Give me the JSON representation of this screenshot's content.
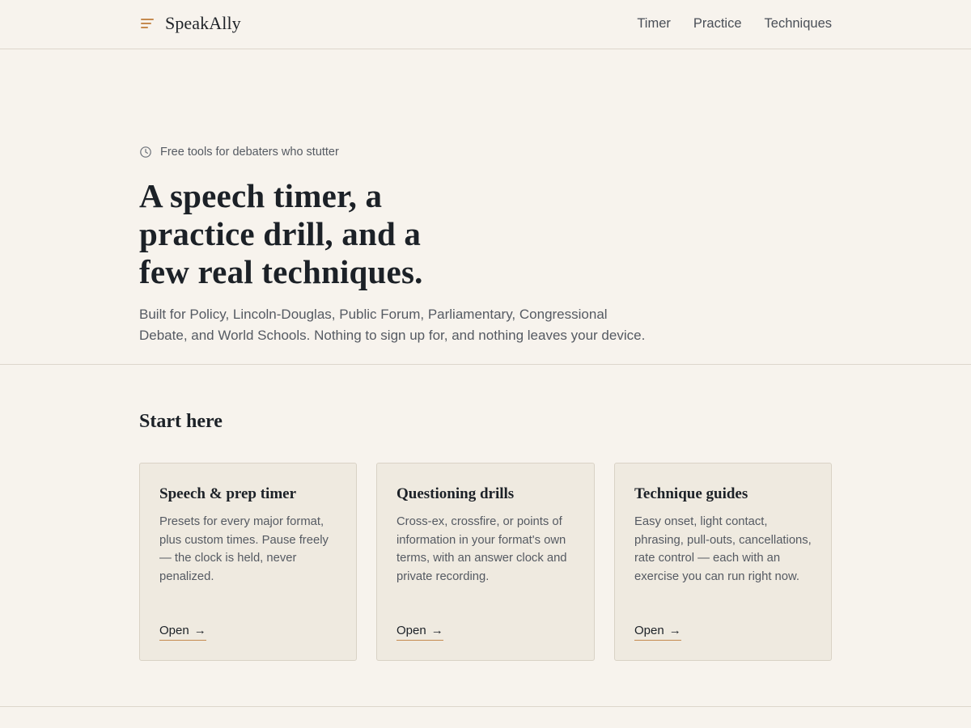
{
  "header": {
    "brand": "SpeakAlly",
    "nav": [
      "Timer",
      "Practice",
      "Techniques"
    ]
  },
  "hero": {
    "eyebrow": "Free tools for debaters who stutter",
    "title": "A speech timer, a practice drill, and a few real techniques.",
    "subtitle": "Built for Policy, Lincoln-Douglas, Public Forum, Parliamentary, Congressional Debate, and World Schools. Nothing to sign up for, and nothing leaves your device."
  },
  "start": {
    "heading": "Start here",
    "cards": [
      {
        "title": "Speech & prep timer",
        "description": "Presets for every major format, plus custom times. Pause freely — the clock is held, never penalized.",
        "link": "Open",
        "arrow": "→"
      },
      {
        "title": "Questioning drills",
        "description": "Cross-ex, crossfire, or points of information in your format's own terms, with an answer clock and private recording.",
        "link": "Open",
        "arrow": "→"
      },
      {
        "title": "Technique guides",
        "description": "Easy onset, light contact, phrasing, pull-outs, cancellations, rate control — each with an exercise you can run right now.",
        "link": "Open",
        "arrow": "→"
      }
    ]
  },
  "colors": {
    "background": "#f7f3ed",
    "card": "#efeae0",
    "accent": "#c58a4f",
    "text": "#1c2127",
    "muted": "#555a62"
  },
  "icons": {
    "brand": "menu-lines-icon",
    "eyebrow": "clock-icon"
  }
}
